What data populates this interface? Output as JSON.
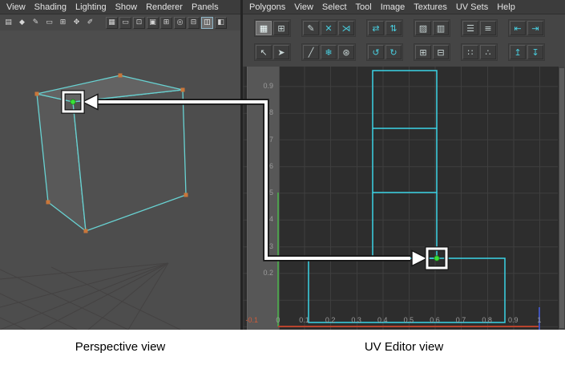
{
  "captions": {
    "left": "Perspective view",
    "right": "UV Editor view"
  },
  "colors": {
    "uv_line": "#3bd4e6",
    "wire": "#68d2d2",
    "vertex": "#c9763a",
    "selected_vertex": "#39e236",
    "axis_u": "#b8442e",
    "axis_v": "#4d9e4d",
    "axis_b": "#4053b8",
    "arrow": "#ffffff"
  },
  "left_pane": {
    "menu": [
      {
        "name": "menu-view",
        "label": "View"
      },
      {
        "name": "menu-shading",
        "label": "Shading"
      },
      {
        "name": "menu-lighting",
        "label": "Lighting"
      },
      {
        "name": "menu-show",
        "label": "Show"
      },
      {
        "name": "menu-renderer",
        "label": "Renderer"
      },
      {
        "name": "menu-panels",
        "label": "Panels"
      }
    ],
    "toolbar_icons": [
      {
        "name": "select-camera-icon",
        "glyph": "▤"
      },
      {
        "name": "lock-camera-icon",
        "glyph": "◆"
      },
      {
        "name": "camera-attributes-icon",
        "glyph": "✎"
      },
      {
        "name": "bookmark-icon",
        "glyph": "▭"
      },
      {
        "name": "image-plane-icon",
        "glyph": "⊞"
      },
      {
        "name": "pan-zoom-icon",
        "glyph": "✥"
      },
      {
        "name": "grease-pencil-icon",
        "glyph": "✐"
      }
    ],
    "toggle_icons": [
      {
        "name": "grid-toggle-icon",
        "glyph": "▦"
      },
      {
        "name": "film-gate-icon",
        "glyph": "▭"
      },
      {
        "name": "resolution-gate-icon",
        "glyph": "⊡"
      },
      {
        "name": "gate-mask-icon",
        "glyph": "▣"
      },
      {
        "name": "field-chart-icon",
        "glyph": "⊞"
      },
      {
        "name": "safe-action-icon",
        "glyph": "◎"
      },
      {
        "name": "safe-title-icon",
        "glyph": "⊟"
      },
      {
        "name": "wireframe-on-shaded-icon",
        "glyph": "◫",
        "active": true
      },
      {
        "name": "xray-icon",
        "glyph": "◧"
      }
    ]
  },
  "right_pane": {
    "menu": [
      {
        "name": "menu-polygons",
        "label": "Polygons"
      },
      {
        "name": "menu-view",
        "label": "View"
      },
      {
        "name": "menu-select",
        "label": "Select"
      },
      {
        "name": "menu-tool",
        "label": "Tool"
      },
      {
        "name": "menu-image",
        "label": "Image"
      },
      {
        "name": "menu-textures",
        "label": "Textures"
      },
      {
        "name": "menu-uv-sets",
        "label": "UV Sets"
      },
      {
        "name": "menu-help",
        "label": "Help"
      }
    ],
    "toolbar": {
      "row1": [
        [
          {
            "name": "uv-lattice-icon",
            "glyph": "▦",
            "active": true
          },
          {
            "name": "uv-smudge-icon",
            "glyph": "⊞"
          }
        ],
        [
          {
            "name": "cut-uv-icon",
            "glyph": "✎"
          },
          {
            "name": "delete-uv-icon",
            "glyph": "✕"
          },
          {
            "name": "split-uv-icon",
            "glyph": "⋊"
          }
        ],
        [
          {
            "name": "flip-u-icon",
            "glyph": "⇄"
          },
          {
            "name": "flip-v-icon",
            "glyph": "⇅"
          }
        ],
        [
          {
            "name": "sew-uv-icon",
            "glyph": "▨"
          },
          {
            "name": "move-and-sew-icon",
            "glyph": "▥"
          }
        ],
        [
          {
            "name": "layout-uv-icon",
            "glyph": "☰"
          },
          {
            "name": "align-shells-icon",
            "glyph": "≡"
          }
        ],
        [
          {
            "name": "snap-left-icon",
            "glyph": "⇤"
          },
          {
            "name": "snap-right-icon",
            "glyph": "⇥"
          }
        ]
      ],
      "row2": [
        [
          {
            "name": "select-uv-tool-icon",
            "glyph": "↖"
          },
          {
            "name": "select-shell-tool-icon",
            "glyph": "➤"
          }
        ],
        [
          {
            "name": "straighten-uv-icon",
            "glyph": "╱"
          },
          {
            "name": "unfold-uv-icon",
            "glyph": "❄"
          },
          {
            "name": "relax-uv-icon",
            "glyph": "⊛"
          }
        ],
        [
          {
            "name": "rotate-ccw-icon",
            "glyph": "↺"
          },
          {
            "name": "rotate-cw-icon",
            "glyph": "↻"
          }
        ],
        [
          {
            "name": "grid-snap-plus-icon",
            "glyph": "⊞"
          },
          {
            "name": "grid-snap-minus-icon",
            "glyph": "⊟"
          }
        ],
        [
          {
            "name": "match-grid-icon",
            "glyph": "∷"
          },
          {
            "name": "pixel-snap-icon",
            "glyph": "∴"
          }
        ],
        [
          {
            "name": "align-top-icon",
            "glyph": "↥"
          },
          {
            "name": "align-bottom-icon",
            "glyph": "↧"
          }
        ]
      ]
    },
    "v_ticks": [
      "0.9",
      "0.8",
      "0.7",
      "0.6",
      "0.5",
      "0.4",
      "0.3",
      "0.2"
    ],
    "u_ticks": [
      "-0.1",
      "0",
      "0.1",
      "0.2",
      "0.3",
      "0.4",
      "0.5",
      "0.6",
      "0.7",
      "0.8",
      "0.9",
      "1"
    ]
  }
}
